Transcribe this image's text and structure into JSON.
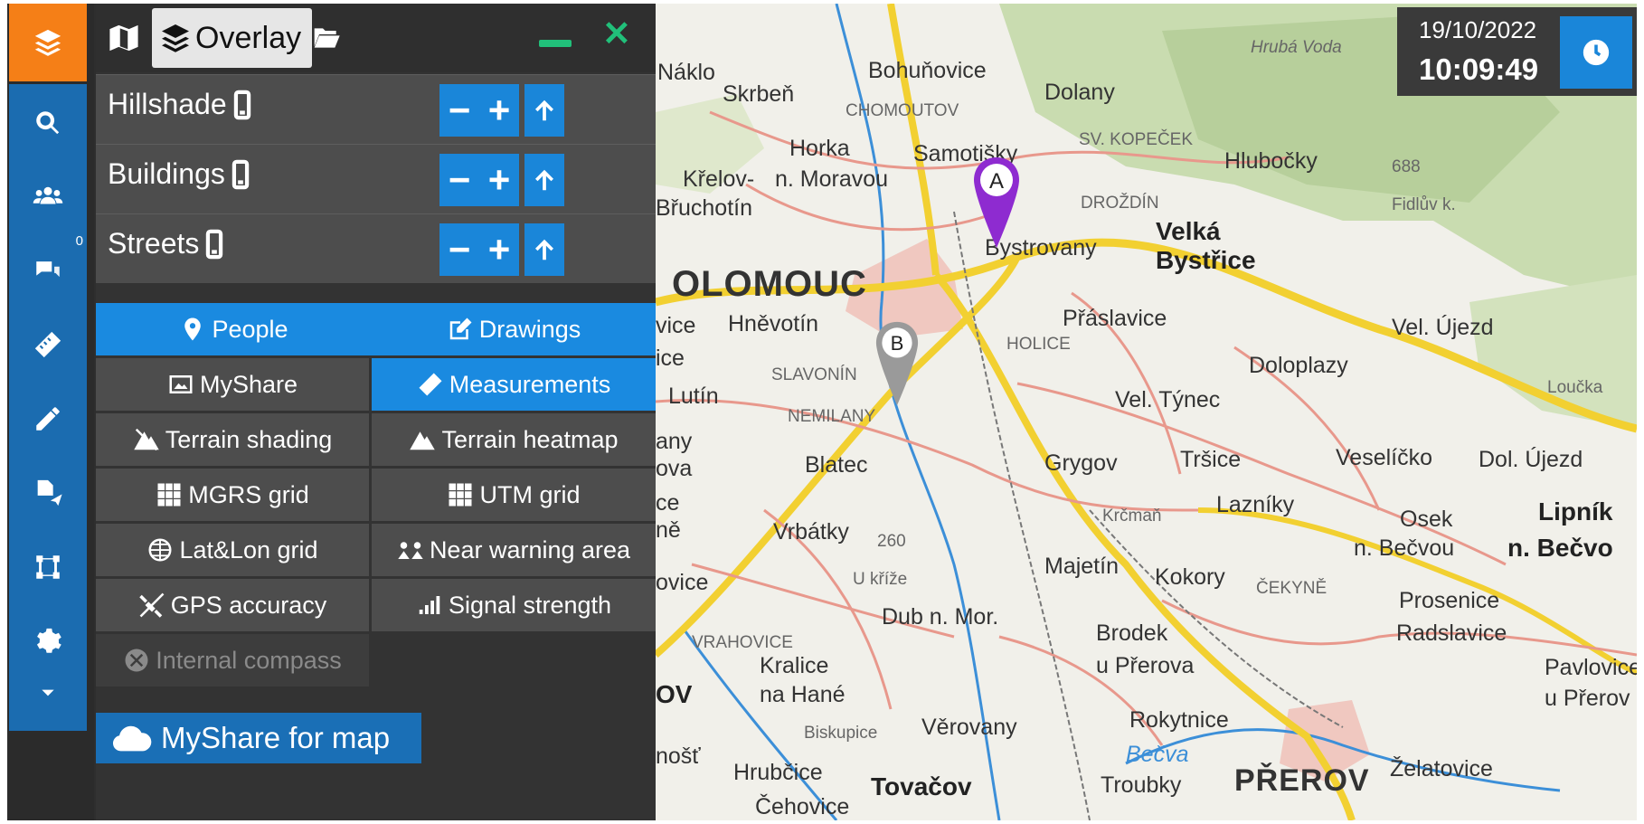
{
  "rail": {
    "notifications_count": "0"
  },
  "panel": {
    "tabs": {
      "overlay_label": "Overlay"
    },
    "layers": [
      {
        "label": "Hillshade"
      },
      {
        "label": "Buildings"
      },
      {
        "label": "Streets"
      }
    ],
    "layer_buttons": {
      "minus": "−",
      "plus": "+"
    },
    "options": [
      {
        "label": "People",
        "icon": "map-pin-icon",
        "on": true
      },
      {
        "label": "Drawings",
        "icon": "edit-icon",
        "on": true
      },
      {
        "label": "MyShare",
        "icon": "image-share-icon",
        "on": false
      },
      {
        "label": "Measurements",
        "icon": "ruler-icon",
        "on": true
      },
      {
        "label": "Terrain shading",
        "icon": "mountain-icon",
        "on": false
      },
      {
        "label": "Terrain heatmap",
        "icon": "mountain-icon",
        "on": false
      },
      {
        "label": "MGRS grid",
        "icon": "grid-icon",
        "on": false
      },
      {
        "label": "UTM grid",
        "icon": "grid-icon",
        "on": false
      },
      {
        "label": "Lat&Lon grid",
        "icon": "globe-grid-icon",
        "on": false
      },
      {
        "label": "Near warning area",
        "icon": "warning-area-icon",
        "on": false
      },
      {
        "label": "GPS accuracy",
        "icon": "satellite-icon",
        "on": false
      },
      {
        "label": "Signal strength",
        "icon": "signal-icon",
        "on": false
      },
      {
        "label": "Internal compass",
        "icon": "compass-icon",
        "on": false,
        "disabled": true
      }
    ],
    "share_button": "MyShare for map"
  },
  "datetime": {
    "date": "19/10/2022",
    "time": "10:09:49"
  },
  "map": {
    "markers": [
      {
        "label": "A",
        "color": "#8e2bd0"
      },
      {
        "label": "B",
        "color": "#9a9a9a"
      }
    ],
    "places": {
      "olomouc": "OLOMOUC",
      "prerov": "PŘEROV",
      "velka_bystrice_1": "Velká",
      "velka_bystrice_2": "Bystřice",
      "lipnik_1": "Lipník",
      "lipnik_2": "n. Bečvo",
      "tovacov": "Tovačov",
      "naklo": "Náklo",
      "skrben": "Skrbeň",
      "bohunovice": "Bohuňovice",
      "dolany": "Dolany",
      "chomoutov": "CHOMOUTOV",
      "hruba_voda": "Hrubá Voda",
      "horka": "Horka",
      "samotisky": "Samotišky",
      "sv_kopecek": "SV. KOPEČEK",
      "hlubocky": "Hlubočky",
      "krelov": "Křelov-",
      "n_moravou": "n. Moravou",
      "bruchotin": "Břuchotín",
      "drozdin": "DROŽDÍN",
      "bystrovany": "Bystrovany",
      "fidluv": "Fidlův k.",
      "e688": "688",
      "hnevotin": "Hněvotín",
      "praslavice": "Přáslavice",
      "vel_ujezd": "Vel. Újezd",
      "holice": "HOLICE",
      "slavonin": "SLAVONÍN",
      "doloplazy": "Doloplazy",
      "lutin": "Lutín",
      "nemilany": "NEMILANY",
      "vel_tynec": "Vel. Týnec",
      "loucka": "Loučka",
      "blatec": "Blatec",
      "grygov": "Grygov",
      "trsice": "Tršice",
      "veselicko": "Veselíčko",
      "dol_ujezd": "Dol. Újezd",
      "krcman": "Krčmaň",
      "lazniky": "Lazníky",
      "vrbatky": "Vrbátky",
      "e260": "260",
      "osek": "Osek",
      "n_becvou": "n. Bečvou",
      "u_krize": "U kříže",
      "majetin": "Majetín",
      "kokory": "Kokory",
      "cekyne": "ČEKYNĚ",
      "prosenice": "Prosenice",
      "dub": "Dub n. Mor.",
      "vrahovice": "VRAHOVICE",
      "brodek": "Brodek",
      "u_prerova": "u Přerova",
      "radslavice": "Radslavice",
      "kralice": "Kralice",
      "na_hane": "na Hané",
      "pavlovice": "Pavlovice",
      "u_prerov": "u Přerov",
      "biskupice": "Biskupice",
      "verovany": "Věrovany",
      "rokytnice": "Rokytnice",
      "hrubcice": "Hrubčice",
      "becva": "Bečva",
      "troubky": "Troubky",
      "zelatovice": "Želatovice",
      "cehovice": "Čehovice",
      "ov": "OV",
      "edge_vice": "vice",
      "edge_ice": "ice",
      "edge_any": "any",
      "edge_ova": "ova",
      "edge_ce": "ce",
      "edge_ne": "ně",
      "edge_ovice": "ovice",
      "edge_nost": "nošť"
    }
  }
}
